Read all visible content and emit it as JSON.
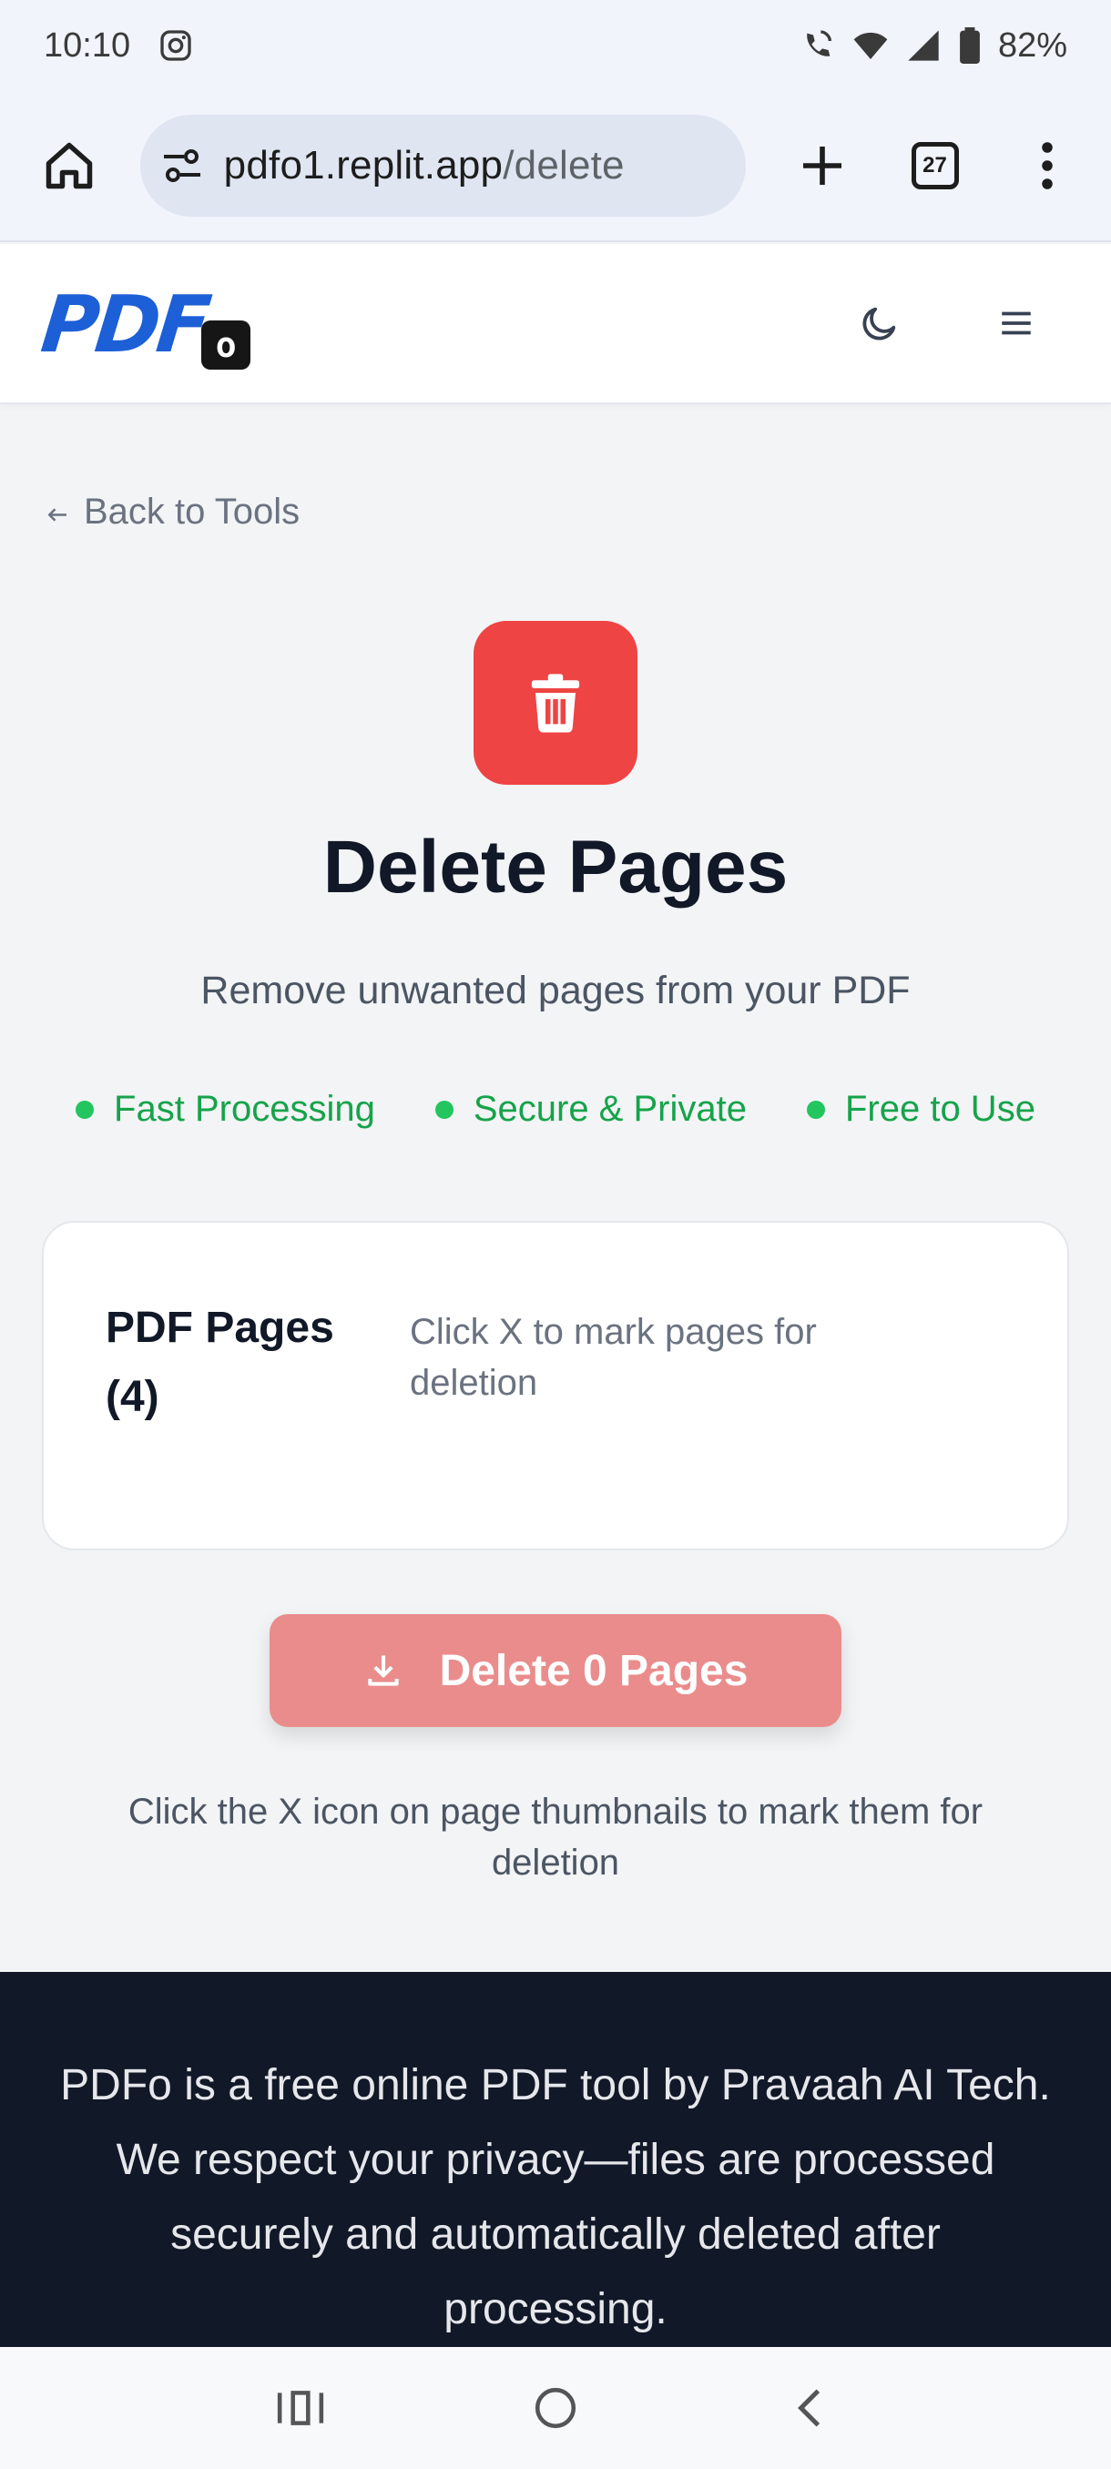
{
  "status_bar": {
    "time": "10:10",
    "battery": "82%"
  },
  "browser": {
    "url_host": "pdfo1.replit.app",
    "url_path": "/delete",
    "tab_count": "27"
  },
  "header": {
    "logo_text": "PDF",
    "logo_badge": "o"
  },
  "main": {
    "back_link": "Back to Tools",
    "title": "Delete Pages",
    "subtitle": "Remove unwanted pages from your PDF",
    "features": [
      "Fast Processing",
      "Secure & Private",
      "Free to Use"
    ],
    "card_title": "PDF Pages (4)",
    "card_hint": "Click X to mark pages for deletion",
    "delete_button": "Delete 0 Pages",
    "help_text": "Click the X icon on page thumbnails to mark them for deletion"
  },
  "footer": {
    "text": "PDFo is a free online PDF tool by Pravaah AI Tech. We respect your privacy—files are processed securely and automatically deleted after processing."
  },
  "colors": {
    "accent_red": "#ef4444",
    "button_disabled_red": "#ea8c8c",
    "feature_green": "#16a34a",
    "logo_blue": "#1d5fd6",
    "footer_bg": "#111827"
  },
  "icons": {
    "hero": "trash-icon",
    "theme": "moon-icon",
    "menu": "hamburger-icon",
    "download": "download-icon"
  }
}
